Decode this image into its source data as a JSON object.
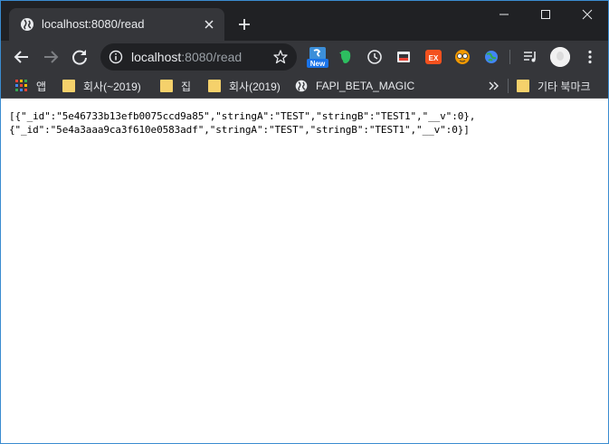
{
  "tab": {
    "title": "localhost:8080/read"
  },
  "omnibox": {
    "host": "localhost",
    "path": ":8080/read"
  },
  "extensions": [
    {
      "name": "new-badge-extension",
      "label": "New",
      "color": "#1a73e8"
    },
    {
      "name": "evernote-extension",
      "color": "#2dbe60"
    },
    {
      "name": "clock-extension",
      "color": "#e8eaed"
    },
    {
      "name": "screenshot-extension",
      "color": "#e8eaed"
    },
    {
      "name": "ex-extension",
      "label": "EX",
      "color": "#f4511e"
    },
    {
      "name": "glasses-extension",
      "color": "#f29900"
    },
    {
      "name": "globe-extension",
      "color": "#4285f4"
    }
  ],
  "bookmarks": {
    "apps": "앱",
    "items": [
      "회사(~2019)",
      "집",
      "회사(2019)",
      "FAPI_BETA_MAGIC"
    ],
    "other": "기타 북마크"
  },
  "page": {
    "json_lines": [
      "[{\"_id\":\"5e46733b13efb0075ccd9a85\",\"stringA\":\"TEST\",\"stringB\":\"TEST1\",\"__v\":0},",
      "{\"_id\":\"5e4a3aaa9ca3f610e0583adf\",\"stringA\":\"TEST\",\"stringB\":\"TEST1\",\"__v\":0}]"
    ]
  }
}
